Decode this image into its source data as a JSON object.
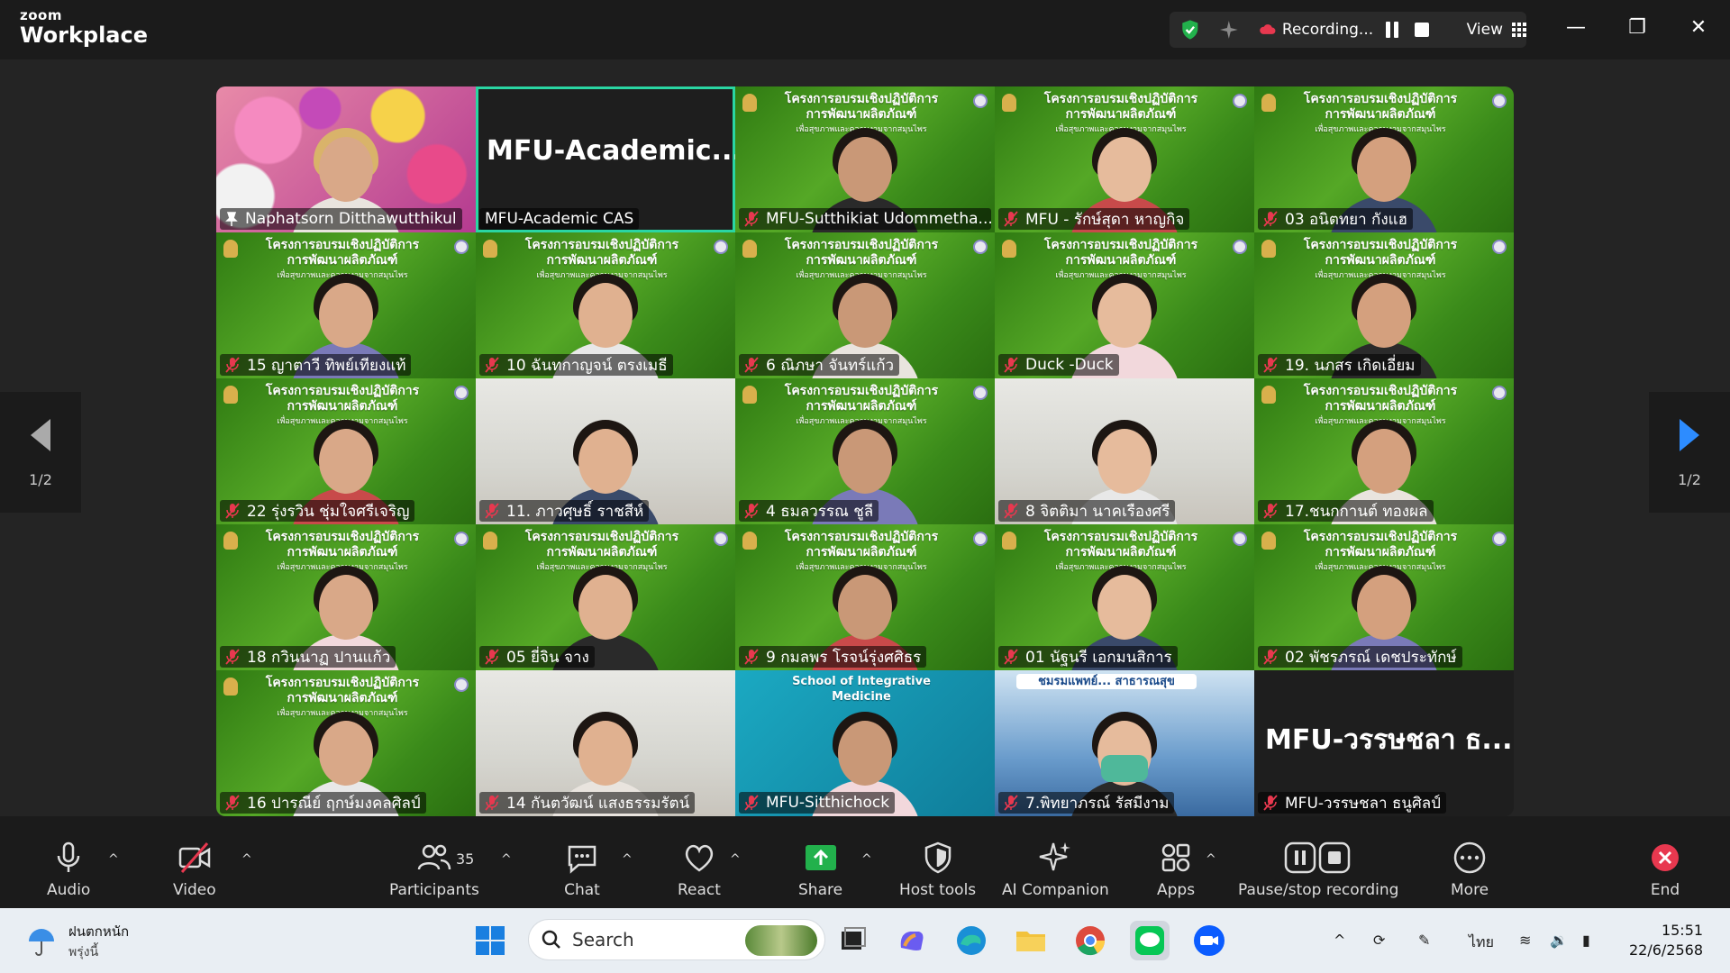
{
  "app": {
    "brand_small": "zoom",
    "brand_large": "Workplace"
  },
  "recording": {
    "status": "Recording...",
    "view_label": "View"
  },
  "pager": {
    "indicator": "1/2"
  },
  "tiles": [
    {
      "name": "Naphatsorn Ditthawutthikul",
      "pinned": true,
      "muted": false,
      "style": "flowers"
    },
    {
      "name": "MFU-Academic CAS",
      "big": "MFU-Academic...",
      "muted": false,
      "style": "dark",
      "active": true
    },
    {
      "name": "MFU-Sutthikiat Udommetha...",
      "muted": true,
      "style": "green"
    },
    {
      "name": "MFU - รักษ์สุดา หาญกิจ",
      "muted": true,
      "style": "green"
    },
    {
      "name": "03 อนิตทยา กังแฮ",
      "muted": true,
      "style": "green"
    },
    {
      "name": "15 ญาตาวี ทิพย์เทียงแท้",
      "muted": true,
      "style": "green"
    },
    {
      "name": "10 ฉันทกาญจน์ ตรงเมธี",
      "muted": true,
      "style": "green"
    },
    {
      "name": "6 ณิภษา จันทร์แก้ว",
      "muted": true,
      "style": "green"
    },
    {
      "name": "Duck -Duck",
      "muted": true,
      "style": "green"
    },
    {
      "name": "19. นภสร เกิดเอี่ยม",
      "muted": true,
      "style": "green"
    },
    {
      "name": "22 รุ่งรวิน ชุ่มใจศรีเจริญ",
      "muted": true,
      "style": "green"
    },
    {
      "name": "11. ภาวศุษธิ์ ราชสีห์",
      "muted": true,
      "style": "room"
    },
    {
      "name": "4 ธมลวรรณ ชูลี",
      "muted": true,
      "style": "green"
    },
    {
      "name": "8 จิตติมา นาคเรืองศรี",
      "muted": true,
      "style": "room"
    },
    {
      "name": "17.ชนกกานต์ ทองผล",
      "muted": true,
      "style": "green"
    },
    {
      "name": "18 กวินนาฏ ปานแก้ว",
      "muted": true,
      "style": "green"
    },
    {
      "name": "05 ยี่จิน จาง",
      "muted": true,
      "style": "green"
    },
    {
      "name": "9 กมลพร โรจน์รุ่งศศิธร",
      "muted": true,
      "style": "green"
    },
    {
      "name": "01 นัฐนรี เอกมนสิการ",
      "muted": true,
      "style": "green"
    },
    {
      "name": "02 พัชรภรณ์ เดชประทักษ์",
      "muted": true,
      "style": "green"
    },
    {
      "name": "16 ปารณีย์ ฤกษ์มงคลศิลป์",
      "muted": true,
      "style": "green"
    },
    {
      "name": "14 กันตวัฒน์ แสงธรรมรัตน์",
      "muted": true,
      "style": "room"
    },
    {
      "name": "MFU-Sitthichock",
      "muted": true,
      "style": "teal",
      "banner": "School of Integrative Medicine"
    },
    {
      "name": "7.พิทยาภรณ์ รัสมีงาม",
      "muted": true,
      "style": "blue",
      "banner": "ชมรมแพทย์... สาธารณสุข"
    },
    {
      "name": "MFU-วรรษชลา ธนูศิลป์",
      "big": "MFU-วรรษชลา ธ...",
      "muted": true,
      "style": "dark"
    }
  ],
  "banner_text": {
    "line1": "โครงการอบรมเชิงปฏิบัติการ",
    "line2": "การพัฒนาผลิตภัณฑ์",
    "line3": "เพื่อสุขภาพและความงามจากสมุนไพร"
  },
  "toolbar": {
    "audio": "Audio",
    "video": "Video",
    "participants": "Participants",
    "participants_count": "35",
    "chat": "Chat",
    "react": "React",
    "share": "Share",
    "host_tools": "Host tools",
    "ai_companion": "AI Companion",
    "apps": "Apps",
    "pause_stop": "Pause/stop recording",
    "more": "More",
    "end": "End"
  },
  "taskbar": {
    "weather_line1": "ฝนตกหนัก",
    "weather_line2": "พรุ่งนี้",
    "search_placeholder": "Search",
    "lang": "ไทย",
    "time": "15:51",
    "date": "22/6/2568"
  }
}
